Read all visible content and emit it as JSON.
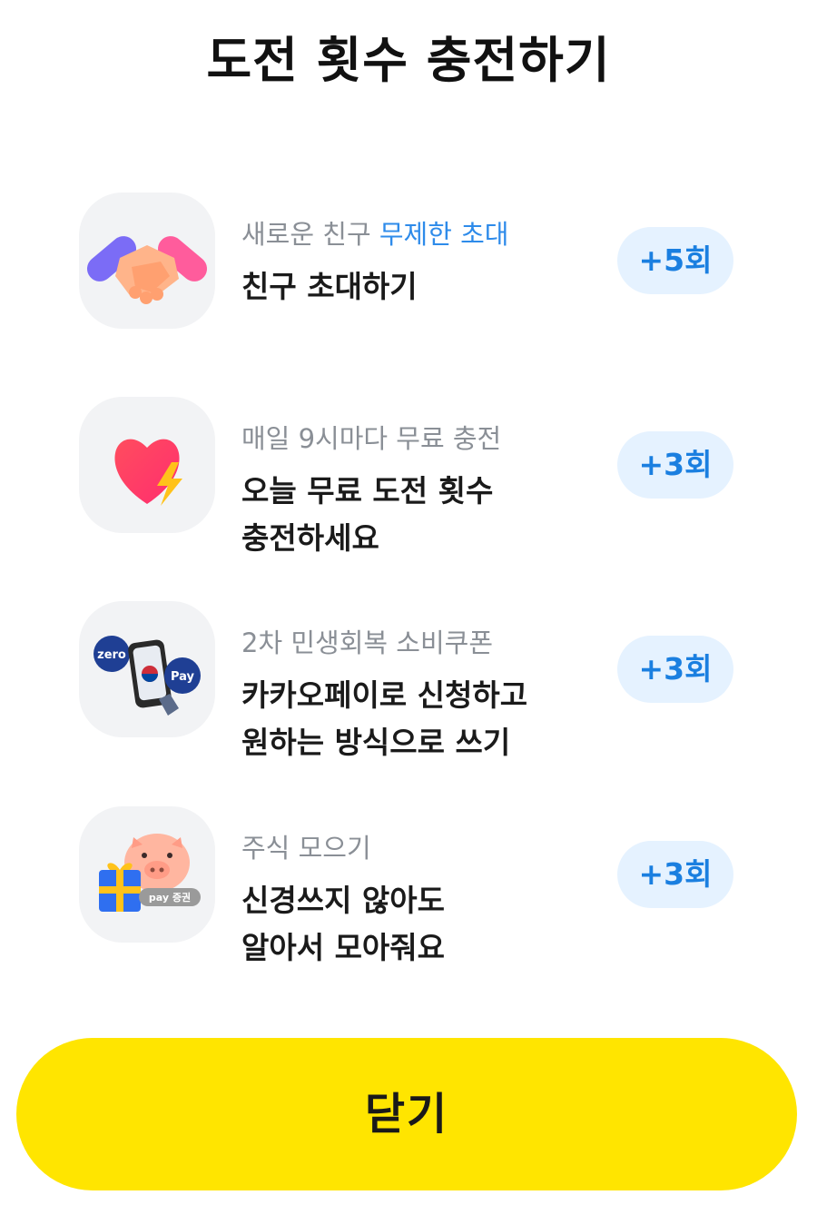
{
  "header": {
    "title": "도전 횟수 충전하기"
  },
  "items": [
    {
      "icon": "handshake-icon",
      "subtitle": "새로운 친구 ",
      "subtitle_accent": "무제한 초대",
      "line1": "친구 초대하기",
      "line2": "",
      "reward": "+5회"
    },
    {
      "icon": "heart-lightning-icon",
      "subtitle": "매일 9시마다 무료 충전",
      "subtitle_accent": "",
      "line1": "오늘 무료 도전 횟수",
      "line2": "충전하세요",
      "reward": "+3회"
    },
    {
      "icon": "phone-pay-icon",
      "subtitle": "2차 민생회복 소비쿠폰",
      "subtitle_accent": "",
      "line1": "카카오페이로 신청하고",
      "line2": "원하는 방식으로 쓰기",
      "reward": "+3회",
      "icon_badges": [
        "zero",
        "Pay"
      ]
    },
    {
      "icon": "piggy-gift-icon",
      "subtitle": "주식 모으기",
      "subtitle_accent": "",
      "line1": "신경쓰지 않아도",
      "line2": "알아서 모아줘요",
      "reward": "+3회",
      "icon_badges": [
        "pay 증권"
      ]
    }
  ],
  "footer": {
    "close_label": "닫기"
  },
  "colors": {
    "accent_blue": "#2e8bea",
    "pill_bg": "#e5f2ff",
    "close_yellow": "#ffe500"
  }
}
